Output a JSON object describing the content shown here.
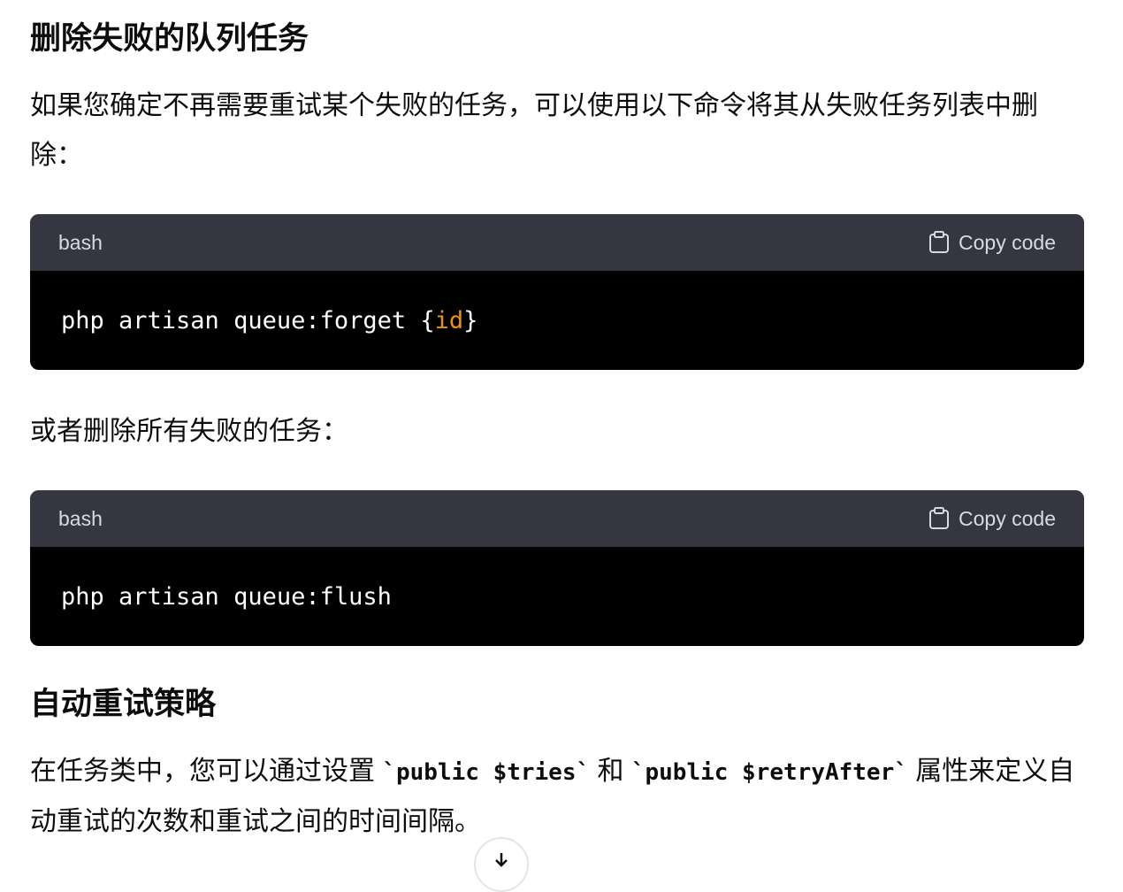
{
  "section1": {
    "heading": "删除失败的队列任务",
    "para": "如果您确定不再需要重试某个失败的任务，可以使用以下命令将其从失败任务列表中删除："
  },
  "code1": {
    "lang": "bash",
    "copy_label": "Copy code",
    "cmd": "php artisan queue:forget ",
    "brace_open": "{",
    "var": "id",
    "brace_close": "}"
  },
  "para2": "或者删除所有失败的任务：",
  "code2": {
    "lang": "bash",
    "copy_label": "Copy code",
    "cmd": "php artisan queue:flush"
  },
  "section2": {
    "heading": "自动重试策略",
    "pre": "在任务类中，您可以通过设置 ",
    "code_a": "`public $tries`",
    "mid": " 和 ",
    "code_b": "`public $retryAfter`",
    "post": " 属性来定义自动重试的次数和重试之间的时间间隔。"
  },
  "colors": {
    "code_header": "#363642",
    "code_bg": "#000000",
    "highlight": "#e9950c"
  },
  "icons": {
    "copy": "clipboard-icon",
    "scroll": "arrow-down-icon"
  }
}
